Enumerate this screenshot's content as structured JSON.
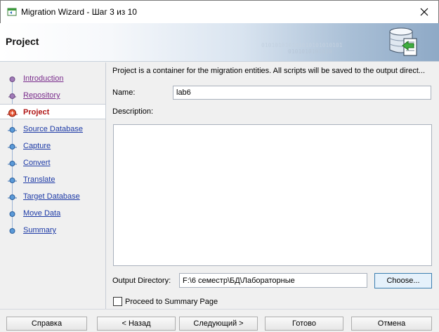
{
  "window": {
    "title": "Migration Wizard - Шаг 3 из 10"
  },
  "banner": {
    "title": "Project",
    "binary_line1": "010101010101010101010101",
    "binary_line2": "0101010101010"
  },
  "nav": {
    "items": [
      {
        "label": "Introduction",
        "state": "visited"
      },
      {
        "label": "Repository",
        "state": "visited"
      },
      {
        "label": "Project",
        "state": "current"
      },
      {
        "label": "Source Database",
        "state": "pending"
      },
      {
        "label": "Capture",
        "state": "pending"
      },
      {
        "label": "Convert",
        "state": "pending"
      },
      {
        "label": "Translate",
        "state": "pending"
      },
      {
        "label": "Target Database",
        "state": "pending"
      },
      {
        "label": "Move Data",
        "state": "pending"
      },
      {
        "label": "Summary",
        "state": "pending"
      }
    ]
  },
  "main": {
    "intro": "Project is a container for the migration entities.  All scripts will be saved to the output direct...",
    "name_label": "Name:",
    "name_value": "lab6",
    "description_label": "Description:",
    "description_value": "",
    "output_dir_label": "Output Directory:",
    "output_dir_value": "F:\\6 семестр\\БД\\Лабораторные",
    "choose_label": "Choose...",
    "proceed_label": "Proceed to Summary Page",
    "proceed_checked": false
  },
  "footer": {
    "help": "Справка",
    "back": "< Назад",
    "next": "Следующий >",
    "finish": "Готово",
    "cancel": "Отмена"
  },
  "colors": {
    "link": "#1d3aa6",
    "visited_link": "#7a2d8c",
    "current_step": "#b01515",
    "focus_border": "#3c7fb1"
  },
  "icons": {
    "app": "wizard-app-icon",
    "close": "close-icon",
    "banner": "database-migrate-icon",
    "step_node": "step-node-icon",
    "current_step": "current-step-icon"
  }
}
